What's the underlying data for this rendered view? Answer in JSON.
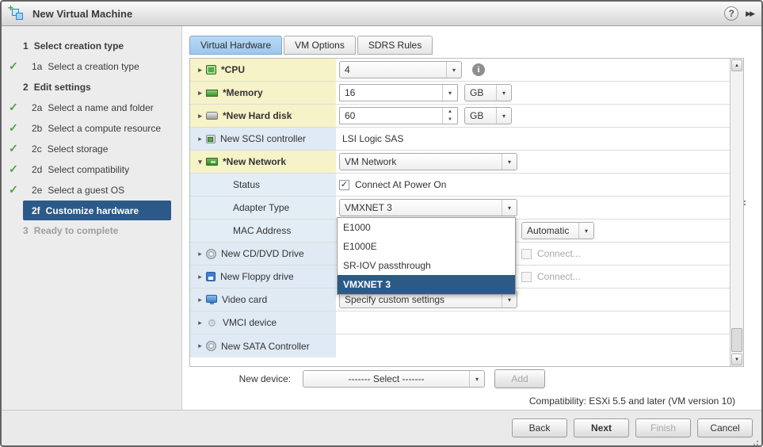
{
  "window": {
    "title": "New Virtual Machine"
  },
  "icons": {
    "help": "?",
    "panel_collapse": "▶▶",
    "plus": "+",
    "check": "✓",
    "twisty_collapsed": "▸",
    "twisty_expanded": "▾",
    "dropdown_arrow": "▾",
    "spin_up": "▲",
    "spin_down": "▼",
    "info": "i",
    "gear": "⚙"
  },
  "sidebar": {
    "steps": [
      {
        "num": "1",
        "label": "Select creation type"
      },
      {
        "num": "1a",
        "label": "Select a creation type"
      },
      {
        "num": "2",
        "label": "Edit settings"
      },
      {
        "num": "2a",
        "label": "Select a name and folder"
      },
      {
        "num": "2b",
        "label": "Select a compute resource"
      },
      {
        "num": "2c",
        "label": "Select storage"
      },
      {
        "num": "2d",
        "label": "Select compatibility"
      },
      {
        "num": "2e",
        "label": "Select a guest OS"
      },
      {
        "num": "2f",
        "label": "Customize hardware"
      },
      {
        "num": "3",
        "label": "Ready to complete"
      }
    ]
  },
  "tabs": [
    {
      "label": "Virtual Hardware"
    },
    {
      "label": "VM Options"
    },
    {
      "label": "SDRS Rules"
    }
  ],
  "hardware": {
    "rows": [
      {
        "label": "*CPU",
        "value": "4"
      },
      {
        "label": "*Memory",
        "value": "16",
        "unit": "GB"
      },
      {
        "label": "*New Hard disk",
        "value": "60",
        "unit": "GB"
      },
      {
        "label": "New SCSI controller",
        "value": "LSI Logic SAS"
      },
      {
        "label": "*New Network",
        "value": "VM Network"
      },
      {
        "label": "Status",
        "value": "Connect At Power On"
      },
      {
        "label": "Adapter Type",
        "value": "VMXNET 3"
      },
      {
        "label": "MAC Address",
        "value": "Automatic"
      },
      {
        "label": "New CD/DVD Drive",
        "value": "Connect..."
      },
      {
        "label": "New Floppy drive",
        "value": "Connect..."
      },
      {
        "label": "Video card",
        "value": "Specify custom settings"
      },
      {
        "label": "VMCI device",
        "value": ""
      },
      {
        "label": "New SATA Controller",
        "value": ""
      }
    ]
  },
  "adapter_dropdown": {
    "options": [
      {
        "label": "E1000"
      },
      {
        "label": "E1000E"
      },
      {
        "label": "SR-IOV passthrough"
      },
      {
        "label": "VMXNET 3"
      }
    ],
    "selected": "VMXNET 3"
  },
  "device_bar": {
    "new_device_label": "New device:",
    "select_value": "------- Select -------",
    "add_label": "Add"
  },
  "compatibility": "Compatibility: ESXi 5.5 and later (VM version 10)",
  "buttons": {
    "back": "Back",
    "next": "Next",
    "finish": "Finish",
    "cancel": "Cancel"
  },
  "colors": {
    "selection_blue": "#2b5a88",
    "required_row_yellow": "#f7f3c8",
    "device_row_blue": "#dfeaf4",
    "tab_active_blue": "#a6cdf0",
    "check_green": "#4ea23c"
  }
}
